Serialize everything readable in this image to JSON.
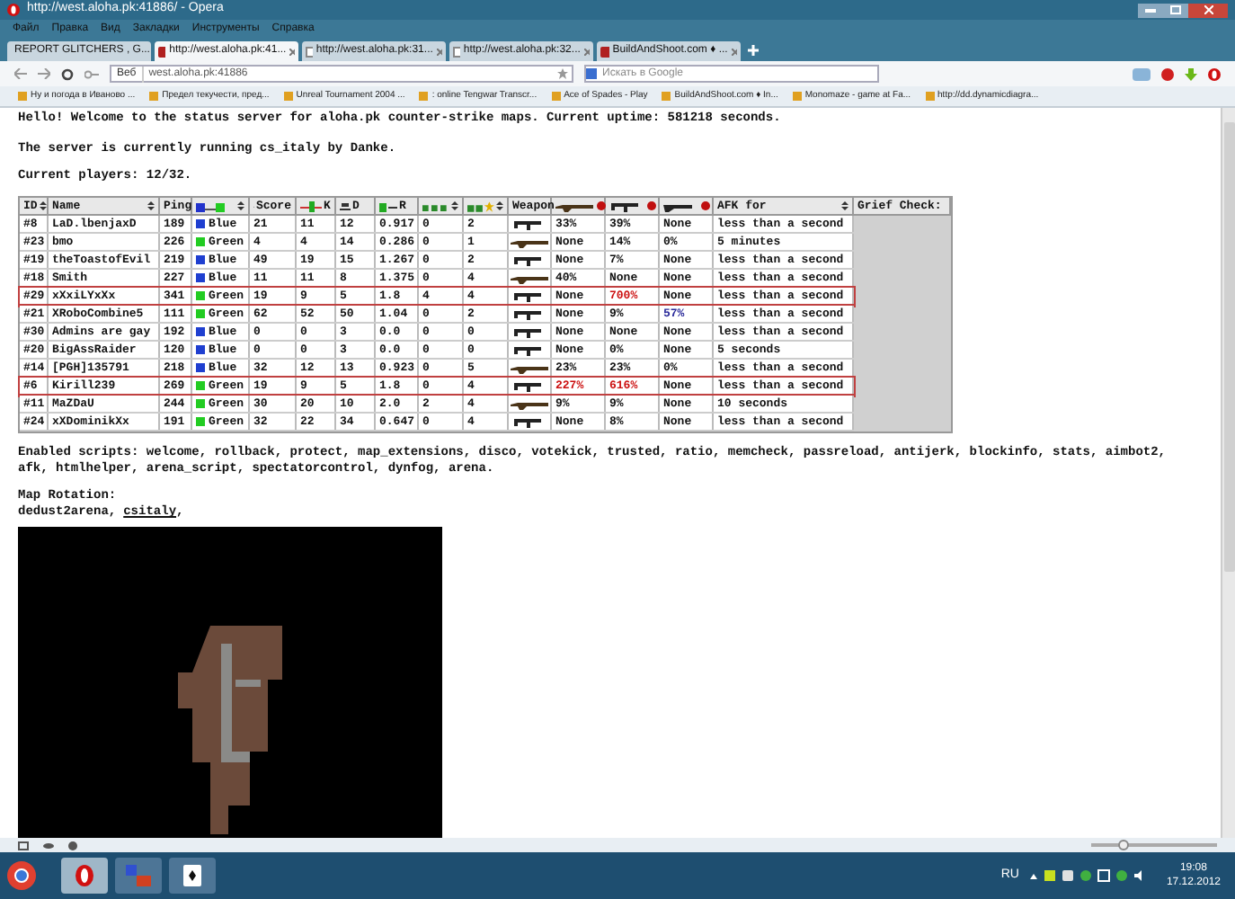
{
  "window": {
    "title": "http://west.aloha.pk:41886/ - Opera"
  },
  "menu": [
    "Файл",
    "Правка",
    "Вид",
    "Закладки",
    "Инструменты",
    "Справка"
  ],
  "tabs": [
    {
      "label": "REPORT GLITCHERS , G...",
      "selected": false,
      "kind": "site"
    },
    {
      "label": "http://west.aloha.pk:41...",
      "selected": true,
      "kind": "site"
    },
    {
      "label": "http://west.aloha.pk:31...",
      "selected": false,
      "kind": "page"
    },
    {
      "label": "http://west.aloha.pk:32...",
      "selected": false,
      "kind": "page"
    },
    {
      "label": "BuildAndShoot.com ♦ ...",
      "selected": false,
      "kind": "site"
    }
  ],
  "address": {
    "badge": "Веб",
    "value": "west.aloha.pk:41886"
  },
  "search": {
    "placeholder": "Искать в Google"
  },
  "bookmarks": [
    "Ну и погода в Иваново ...",
    "Предел текучести, пред...",
    "Unreal Tournament 2004 ...",
    ": online Tengwar Transcr...",
    "Ace of Spades - Play",
    "BuildAndShoot.com ♦ In...",
    "Monomaze - game at Fa...",
    "http://dd.dynamicdiagra..."
  ],
  "page": {
    "welcome": "Hello! Welcome to the status server for aloha.pk counter-strike maps. Current uptime: 581218 seconds.",
    "running": "The server is currently running cs_italy by Danke.",
    "players": "Current players: 12/32.",
    "table": {
      "columns": [
        {
          "label": "ID",
          "sortable": true
        },
        {
          "label": "Name",
          "sortable": true
        },
        {
          "label": "Ping",
          "sortable": false
        },
        {
          "kind": "team",
          "sortable": true
        },
        {
          "kind": "score",
          "label": "Score",
          "sortable": false
        },
        {
          "kind": "kills",
          "label": "K",
          "sortable": false
        },
        {
          "kind": "deaths",
          "label": "D",
          "sortable": false
        },
        {
          "kind": "ratio",
          "label": "R",
          "sortable": false
        },
        {
          "kind": "blocks",
          "sortable": true
        },
        {
          "kind": "stars",
          "sortable": true
        },
        {
          "label": "Weapon",
          "sortable": false
        },
        {
          "kind": "rifle",
          "sortable": false
        },
        {
          "kind": "smg",
          "sortable": false
        },
        {
          "kind": "shotgun",
          "sortable": false
        },
        {
          "label": "AFK for",
          "sortable": true
        },
        {
          "label": "Grief Check:",
          "sortable": false
        }
      ],
      "rows": [
        {
          "flagged": false,
          "cells": [
            "#8",
            "LaD.lbenjaxD",
            "189"
          ],
          "team": {
            "label": "Blue",
            "color": "#1f3fd0"
          },
          "stats": [
            "21",
            "11",
            "12",
            "0.917",
            "0",
            "2"
          ],
          "kind": "smg",
          "hits": [
            {
              "text": "33%"
            },
            {
              "text": "39%"
            },
            {
              "text": "None"
            }
          ],
          "afk": "less than a second"
        },
        {
          "flagged": false,
          "cells": [
            "#23",
            "bmo",
            "226"
          ],
          "team": {
            "label": "Green",
            "color": "#22cc22"
          },
          "stats": [
            "4",
            "4",
            "14",
            "0.286",
            "0",
            "1"
          ],
          "kind": "rifle",
          "hits": [
            {
              "text": "None"
            },
            {
              "text": "14%"
            },
            {
              "text": "0%"
            }
          ],
          "afk": "5 minutes"
        },
        {
          "flagged": false,
          "cells": [
            "#19",
            "theToastofEvil",
            "219"
          ],
          "team": {
            "label": "Blue",
            "color": "#1f3fd0"
          },
          "stats": [
            "49",
            "19",
            "15",
            "1.267",
            "0",
            "2"
          ],
          "kind": "smg",
          "hits": [
            {
              "text": "None"
            },
            {
              "text": "7%"
            },
            {
              "text": "None"
            }
          ],
          "afk": "less than a second"
        },
        {
          "flagged": false,
          "cells": [
            "#18",
            "Smith",
            "227"
          ],
          "team": {
            "label": "Blue",
            "color": "#1f3fd0"
          },
          "stats": [
            "11",
            "11",
            "8",
            "1.375",
            "0",
            "4"
          ],
          "kind": "rifle",
          "hits": [
            {
              "text": "40%"
            },
            {
              "text": "None"
            },
            {
              "text": "None"
            }
          ],
          "afk": "less than a second"
        },
        {
          "flagged": true,
          "cells": [
            "#29",
            "xXxiLYxXx",
            "341"
          ],
          "team": {
            "label": "Green",
            "color": "#22cc22"
          },
          "stats": [
            "19",
            "9",
            "5",
            "1.8",
            "4",
            "4"
          ],
          "kind": "smg",
          "hits": [
            {
              "text": "None"
            },
            {
              "text": "700%",
              "color": "#cc1111"
            },
            {
              "text": "None"
            }
          ],
          "afk": "less than a second"
        },
        {
          "flagged": false,
          "cells": [
            "#21",
            "XRoboCombine5",
            "111"
          ],
          "team": {
            "label": "Green",
            "color": "#22cc22"
          },
          "stats": [
            "62",
            "52",
            "50",
            "1.04",
            "0",
            "2"
          ],
          "kind": "smg",
          "hits": [
            {
              "text": "None"
            },
            {
              "text": "9%"
            },
            {
              "text": "57%",
              "color": "#2a2a9a"
            }
          ],
          "afk": "less than a second"
        },
        {
          "flagged": false,
          "cells": [
            "#30",
            "Admins are gay",
            "192"
          ],
          "team": {
            "label": "Blue",
            "color": "#1f3fd0"
          },
          "stats": [
            "0",
            "0",
            "3",
            "0.0",
            "0",
            "0"
          ],
          "kind": "smg",
          "hits": [
            {
              "text": "None"
            },
            {
              "text": "None"
            },
            {
              "text": "None"
            }
          ],
          "afk": "less than a second"
        },
        {
          "flagged": false,
          "cells": [
            "#20",
            "BigAssRaider",
            "120"
          ],
          "team": {
            "label": "Blue",
            "color": "#1f3fd0"
          },
          "stats": [
            "0",
            "0",
            "3",
            "0.0",
            "0",
            "0"
          ],
          "kind": "smg",
          "hits": [
            {
              "text": "None"
            },
            {
              "text": "0%"
            },
            {
              "text": "None"
            }
          ],
          "afk": "5 seconds"
        },
        {
          "flagged": false,
          "cells": [
            "#14",
            "[PGH]135791",
            "218"
          ],
          "team": {
            "label": "Blue",
            "color": "#1f3fd0"
          },
          "stats": [
            "32",
            "12",
            "13",
            "0.923",
            "0",
            "5"
          ],
          "kind": "rifle",
          "hits": [
            {
              "text": "23%"
            },
            {
              "text": "23%"
            },
            {
              "text": "0%"
            }
          ],
          "afk": "less than a second"
        },
        {
          "flagged": true,
          "cells": [
            "#6",
            "Kirill239",
            "269"
          ],
          "team": {
            "label": "Green",
            "color": "#22cc22"
          },
          "stats": [
            "19",
            "9",
            "5",
            "1.8",
            "0",
            "4"
          ],
          "kind": "smg",
          "hits": [
            {
              "text": "227%",
              "color": "#cc1111"
            },
            {
              "text": "616%",
              "color": "#cc1111"
            },
            {
              "text": "None"
            }
          ],
          "afk": "less than a second"
        },
        {
          "flagged": false,
          "cells": [
            "#11",
            "MaZDaU",
            "244"
          ],
          "team": {
            "label": "Green",
            "color": "#22cc22"
          },
          "stats": [
            "30",
            "20",
            "10",
            "2.0",
            "2",
            "4"
          ],
          "kind": "rifle",
          "hits": [
            {
              "text": "9%"
            },
            {
              "text": "9%"
            },
            {
              "text": "None"
            }
          ],
          "afk": "10 seconds"
        },
        {
          "flagged": false,
          "cells": [
            "#24",
            "xXDominikXx",
            "191"
          ],
          "team": {
            "label": "Green",
            "color": "#22cc22"
          },
          "stats": [
            "32",
            "22",
            "34",
            "0.647",
            "0",
            "4"
          ],
          "kind": "smg",
          "hits": [
            {
              "text": "None"
            },
            {
              "text": "8%"
            },
            {
              "text": "None"
            }
          ],
          "afk": "less than a second"
        }
      ]
    },
    "scripts": "Enabled scripts: welcome, rollback, protect, map_extensions, disco, votekick, trusted, ratio, memcheck, passreload, antijerk, blockinfo, stats, aimbot2, afk, htmlhelper, arena_script, spectatorcontrol, dynfog, arena.",
    "rotation_label": "Map Rotation:",
    "rotation": [
      {
        "text": "dedust2arena,",
        "link": false
      },
      {
        "text": "csitaly",
        "link": true
      },
      {
        "text": ",",
        "link": false
      }
    ]
  },
  "zoom": {
    "level": 0.25
  },
  "taskbar": {
    "language": "RU",
    "time": "19:08",
    "date": "17.12.2012"
  }
}
